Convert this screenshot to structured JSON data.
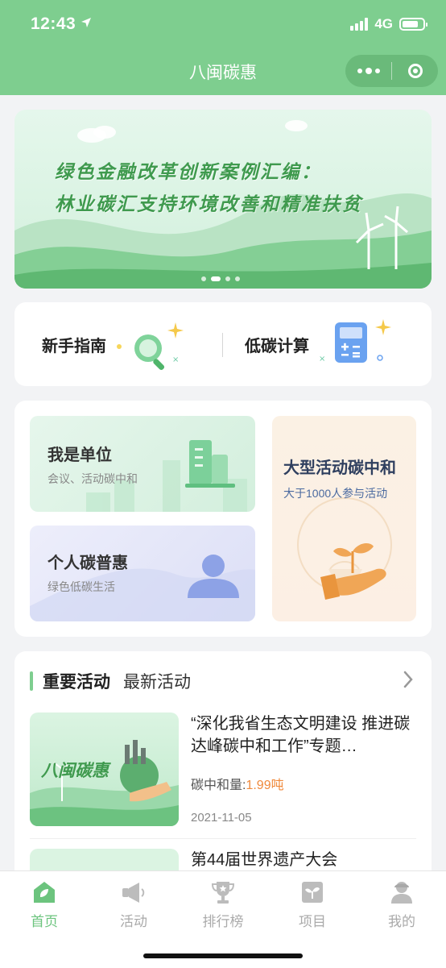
{
  "status_bar": {
    "time": "12:43",
    "network": "4G"
  },
  "nav": {
    "title": "八闽碳惠"
  },
  "banner": {
    "line1": "绿色金融改革创新案例汇编：",
    "line2": "林业碳汇支持环境改善和精准扶贫",
    "slide_count": 4,
    "active_slide": 2
  },
  "quick_entries": [
    {
      "label": "新手指南",
      "icon": "magnifier-icon"
    },
    {
      "label": "低碳计算",
      "icon": "calculator-icon"
    }
  ],
  "services": {
    "unit": {
      "title": "我是单位",
      "subtitle": "会议、活动碳中和"
    },
    "personal": {
      "title": "个人碳普惠",
      "subtitle": "绿色低碳生活"
    },
    "large_event": {
      "title": "大型活动碳中和",
      "subtitle": "大于1000人参与活动"
    }
  },
  "activities": {
    "tab_important": "重要活动",
    "tab_latest": "最新活动",
    "items": [
      {
        "thumb_text": "八闽碳惠",
        "title": "“深化我省生态文明建设 推进碳达峰碳中和工作”专题…",
        "reduction_label": "碳中和量:",
        "reduction_value": "1.99吨",
        "date": "2021-11-05"
      },
      {
        "title": "第44届世界遗产大会"
      }
    ]
  },
  "tabbar": [
    {
      "label": "首页",
      "icon": "home-icon",
      "active": true
    },
    {
      "label": "活动",
      "icon": "megaphone-icon",
      "active": false
    },
    {
      "label": "排行榜",
      "icon": "trophy-icon",
      "active": false
    },
    {
      "label": "项目",
      "icon": "sprout-icon",
      "active": false
    },
    {
      "label": "我的",
      "icon": "user-icon",
      "active": false
    }
  ],
  "colors": {
    "brand_green": "#7ece8f",
    "active_tab": "#6cc47e",
    "highlight_orange": "#f08a3c"
  }
}
